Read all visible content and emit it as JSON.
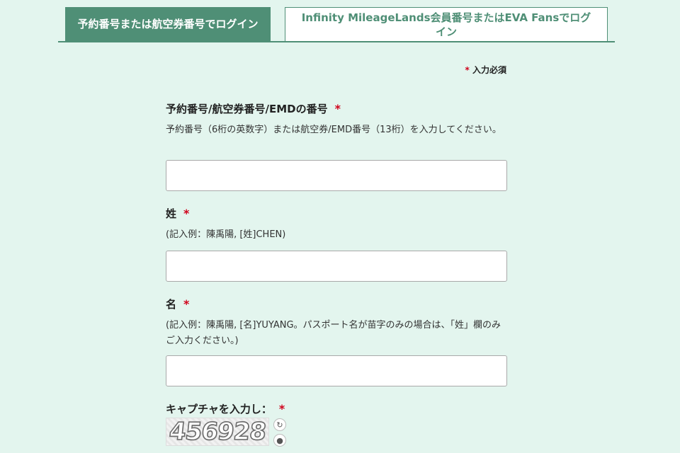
{
  "tabs": [
    {
      "label": "予約番号または航空券番号でログイン",
      "active": true
    },
    {
      "label": "Infinity MileageLands会員番号またはEVA Fansでログイン",
      "active": false
    }
  ],
  "required_note": "入力必須",
  "fields": {
    "booking": {
      "label": "予約番号/航空券番号/EMDの番号",
      "hint": "予約番号（6桁の英数字）または航空券/EMD番号（13桁）を入力してください。",
      "value": ""
    },
    "surname": {
      "label": "姓",
      "hint": "(記入例：陳禹陽,  [姓]CHEN)",
      "value": ""
    },
    "given_name": {
      "label": "名",
      "hint": "(記入例：陳禹陽,  [名]YUYANG。パスポート名が苗字のみの場合は、「姓」欄のみご入力ください。)",
      "value": ""
    },
    "captcha": {
      "label": "キャプチャを入力し：",
      "image_text": "456928"
    }
  },
  "icons": {
    "refresh": "refresh-icon",
    "audio": "audio-icon"
  },
  "colors": {
    "background": "#e3f5ee",
    "tab_active": "#4f8f76",
    "required": "#d0021b"
  }
}
